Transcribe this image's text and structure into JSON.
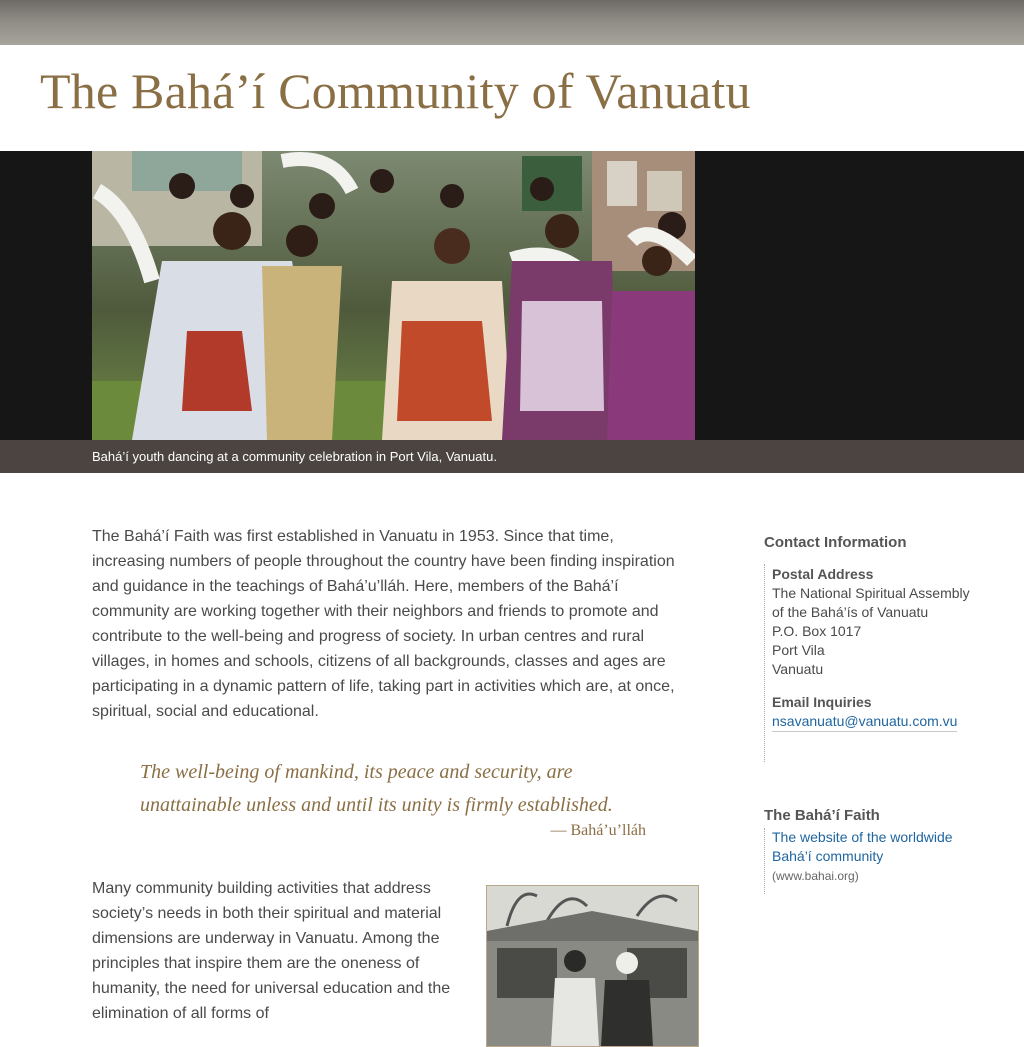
{
  "site": {
    "title": "The Bahá’í Community of Vanuatu"
  },
  "hero": {
    "caption": "Bahá’í youth dancing at a community celebration in Port Vila, Vanuatu."
  },
  "main": {
    "intro": "The Bahá’í Faith was first established in Vanuatu in 1953. Since that time, increasing numbers of people throughout the country have been finding inspiration and guidance in the teachings of Bahá’u’lláh. Here, members of the Bahá’í community are working together with their neighbors and friends to promote and contribute to the well-being and progress of society. In urban centres and rural villages, in homes and schools, citizens of all backgrounds, classes and ages are participating in a dynamic pattern of life, taking part in activities which are, at once, spiritual, social and educational.",
    "quote": "The well-being of mankind, its peace and security, are unattainable unless and until its unity is firmly established.",
    "quote_attribution": "— Bahá’u’lláh",
    "body2": "Many community building activities that address society’s needs in both their spiritual and material dimensions are underway in Vanuatu. Among the principles that inspire them are the oneness of humanity, the need for universal education and the elimination of all forms of"
  },
  "sidebar": {
    "contact_heading": "Contact Information",
    "postal_heading": "Postal Address",
    "postal_lines": [
      "The National Spiritual Assembly",
      "of the Bahá’ís of Vanuatu",
      "P.O. Box 1017",
      "Port Vila",
      "Vanuatu"
    ],
    "email_heading": "Email Inquiries",
    "email": "nsavanuatu@vanuatu.com.vu",
    "faith_heading": "The Bahá’í Faith",
    "faith_link_line1": "The website of the worldwide",
    "faith_link_line2": "Bahá’í community",
    "faith_url_note": "(www.bahai.org)"
  },
  "colors": {
    "title": "#8a6f45",
    "link": "#1f65a0",
    "caption_bar": "#4b4440",
    "hero_bg": "#161616"
  }
}
